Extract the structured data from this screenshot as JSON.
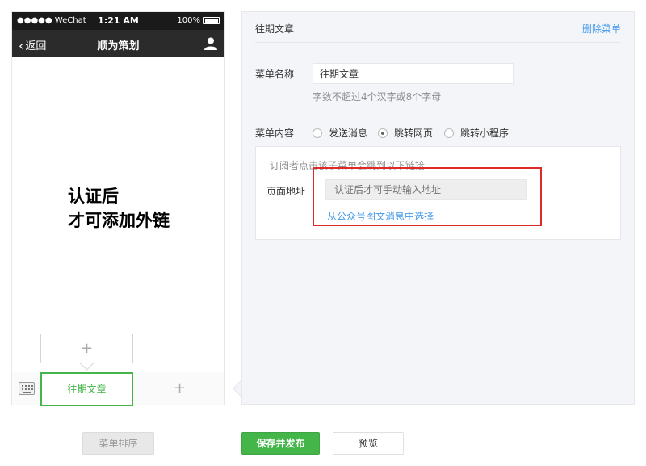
{
  "phone": {
    "status": {
      "carrier": "●●●●● WeChat",
      "time": "1:21 AM",
      "battery": "100%"
    },
    "nav": {
      "back_label": "返回",
      "title": "顺为策划"
    },
    "submenu_add": "+",
    "menu_items": [
      {
        "label": "往期文章",
        "active": true
      }
    ],
    "menu_add": "+"
  },
  "annotation": {
    "line1": "认证后",
    "line2": "才可添加外链"
  },
  "panel": {
    "title": "往期文章",
    "delete_label": "删除菜单",
    "name_label": "菜单名称",
    "name_value": "往期文章",
    "name_hint": "字数不超过4个汉字或8个字母",
    "content_label": "菜单内容",
    "content_options": [
      {
        "label": "发送消息",
        "selected": false
      },
      {
        "label": "跳转网页",
        "selected": true
      },
      {
        "label": "跳转小程序",
        "selected": false
      }
    ],
    "box_description": "订阅者点击该子菜单会跳到以下链接",
    "url_label": "页面地址",
    "url_placeholder": "认证后才可手动输入地址",
    "choose_link": "从公众号图文消息中选择"
  },
  "buttons": {
    "sort": "菜单排序",
    "save": "保存并发布",
    "preview": "预览"
  },
  "colors": {
    "accent_green": "#44b549",
    "link_blue": "#459ae9",
    "highlight_red": "#e02a2a"
  }
}
